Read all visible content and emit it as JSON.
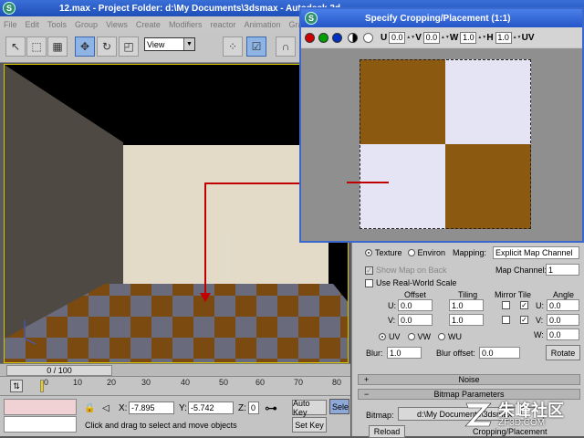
{
  "main_window": {
    "title": "12.max   - Project Folder: d:\\My Documents\\3dsmax  - Autodesk 3d"
  },
  "menu": [
    "File",
    "Edit",
    "Tools",
    "Group",
    "Views",
    "Create",
    "Modifiers",
    "reactor",
    "Animation",
    "Gra"
  ],
  "toolbar": {
    "view_dropdown": "View",
    "icons": [
      "select-arrow-icon",
      "region-select-icon",
      "select-filter-icon",
      "move-icon",
      "rotate-icon",
      "scale-icon",
      "view-coord-icon",
      "pivot-icon",
      "snap-icon",
      "magnet-icon"
    ]
  },
  "timeline": {
    "frame_counter": "0 / 100",
    "ticks": [
      "0",
      "10",
      "20",
      "30",
      "40",
      "50",
      "60",
      "70",
      "80"
    ]
  },
  "status": {
    "x_label": "X:",
    "x_value": "-7.895",
    "y_label": "Y:",
    "y_value": "-5.742",
    "z_label": "Z:",
    "z_value": "0",
    "prompt": "Click and drag to select and move objects",
    "auto_key": "Auto Key",
    "set_key": "Set Key",
    "selected": "Selec"
  },
  "dialog": {
    "title": "Specify Cropping/Placement (1:1)",
    "channels": [
      "#d00000",
      "#00a000",
      "#0030c0"
    ],
    "u_label": "U",
    "u_value": "0.0",
    "v_label": "V",
    "v_value": "0.0",
    "w_label": "W",
    "w_value": "1.0",
    "h_label": "H",
    "h_value": "1.0",
    "uv_label": "UV",
    "checker_colors": [
      "#8b5a10",
      "#e4e4f4"
    ]
  },
  "material": {
    "texture_label": "Texture",
    "environ_label": "Environ",
    "mapping_label": "Mapping:",
    "mapping_value": "Explicit Map Channel",
    "show_map_on_back": "Show Map on Back",
    "map_channel_label": "Map Channel:",
    "map_channel_value": "1",
    "use_real_world": "Use Real-World Scale",
    "offset_header": "Offset",
    "tiling_header": "Tiling",
    "mirror_tile_header": "Mirror Tile",
    "angle_header": "Angle",
    "u_label": "U:",
    "v_label": "V:",
    "w_label": "W:",
    "u_offset": "0.0",
    "v_offset": "0.0",
    "u_tiling": "1.0",
    "v_tiling": "1.0",
    "u_angle": "0.0",
    "v_angle": "0.0",
    "w_angle": "0.0",
    "uv_radio": "UV",
    "vw_radio": "VW",
    "wu_radio": "WU",
    "blur_label": "Blur:",
    "blur_value": "1.0",
    "blur_offset_label": "Blur offset:",
    "blur_offset_value": "0.0",
    "rotate_button": "Rotate",
    "noise_rollout": "Noise",
    "bitmap_params_rollout": "Bitmap Parameters",
    "bitmap_label": "Bitmap:",
    "bitmap_path": "d:\\My Documents\\3dsmax",
    "reload_button": "Reload",
    "cropping_header": "Cropping/Placement"
  },
  "watermark": {
    "logo_text": "朱峰社区",
    "logo_url": "ZF3D.COM"
  }
}
